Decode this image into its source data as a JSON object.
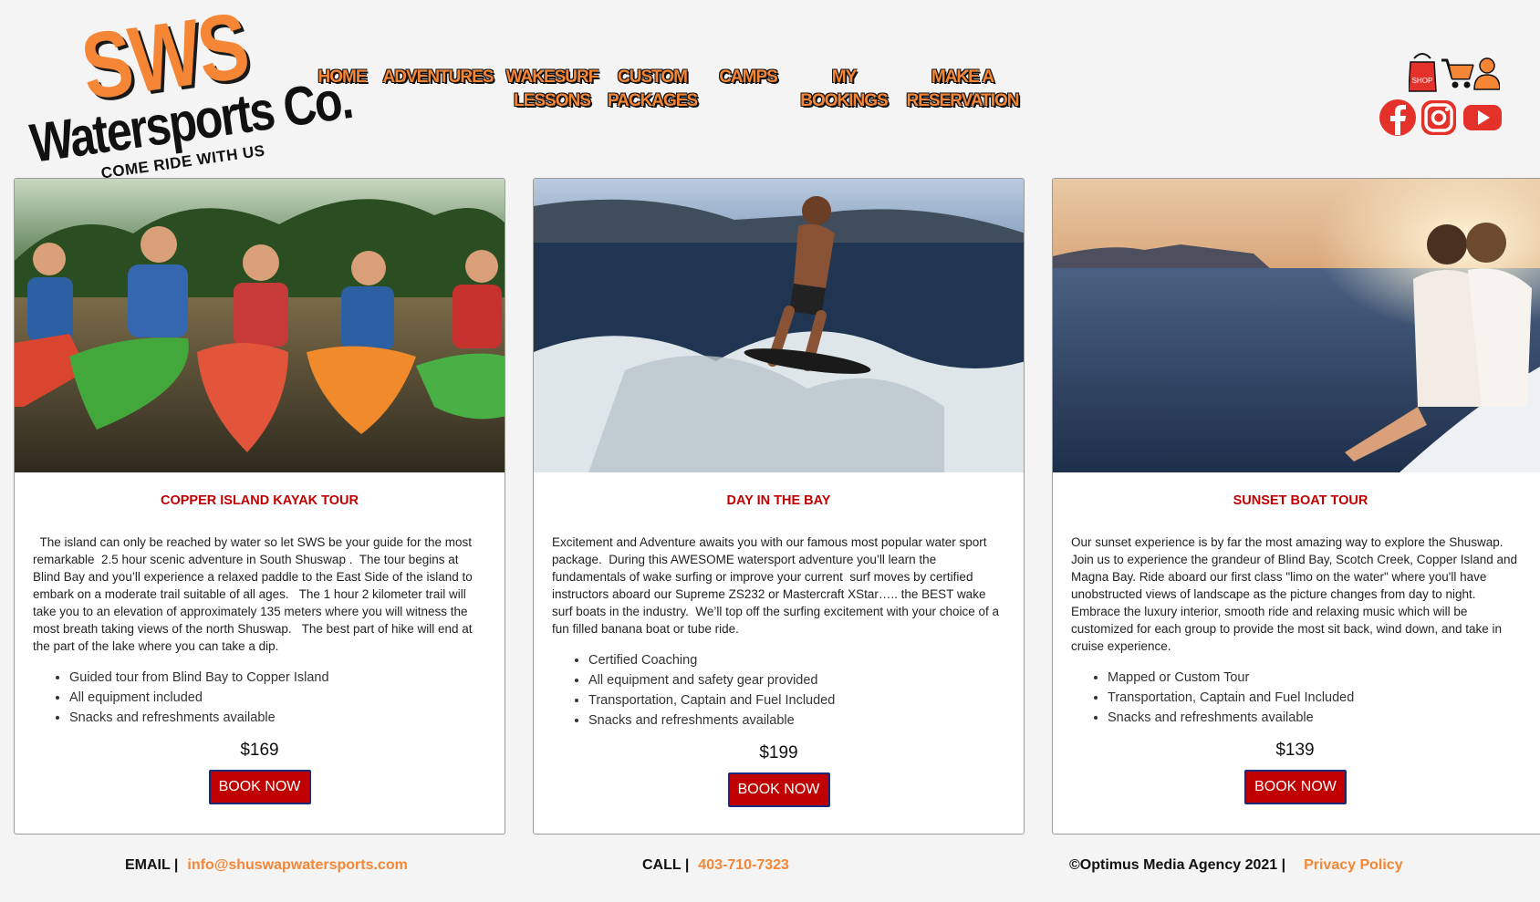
{
  "brand": {
    "logo_main": "SWS",
    "logo_sub": "Watersports Co.",
    "logo_tagline": "COME RIDE WITH US",
    "accent": "#f58636",
    "red": "#c00000"
  },
  "nav": {
    "items": [
      {
        "label": "HOME"
      },
      {
        "label": "ADVENTURES"
      },
      {
        "label": "WAKESURF\nLESSONS"
      },
      {
        "label": "CUSTOM\nPACKAGES"
      },
      {
        "label": "CAMPS"
      },
      {
        "label": "MY\nBOOKINGS"
      },
      {
        "label": "MAKE A\nRESERVATION"
      }
    ]
  },
  "header_icons": {
    "shop_label": "SHOP",
    "icons": [
      "shop-bag-icon",
      "cart-icon",
      "account-icon",
      "facebook-icon",
      "instagram-icon",
      "youtube-icon"
    ]
  },
  "cards": [
    {
      "title": "COPPER ISLAND KAYAK TOUR",
      "description": "  The island can only be reached by water so let SWS be your guide for the most remarkable  2.5 hour scenic adventure in South Shuswap .  The tour begins at Blind Bay and you’ll experience a relaxed paddle to the East Side of the island to embark on a moderate trail suitable of all ages.   The 1 hour 2 kilometer trail will take you to an elevation of approximately 135 meters where you will witness the most breath taking views of the north Shuswap.   The best part of hike will end at the part of the lake where you can take a dip.",
      "bullets": [
        "Guided tour from Blind Bay to Copper Island",
        "All equipment included",
        "Snacks and refreshments available"
      ],
      "price": "$169",
      "button": "BOOK NOW"
    },
    {
      "title": "DAY IN THE BAY",
      "description": "Excitement and Adventure awaits you with our famous most popular water sport package.  During this AWESOME watersport adventure you’ll learn the fundamentals of wake surfing or improve your current  surf moves by certified instructors aboard our Supreme ZS232 or Mastercraft XStar….. the BEST wake surf boats in the industry.  We’ll top off the surfing excitement with your choice of a fun filled banana boat or tube ride.",
      "bullets": [
        "Certified Coaching",
        "All equipment and safety gear provided",
        "Transportation, Captain and Fuel Included",
        "Snacks and refreshments available"
      ],
      "price": "$199",
      "button": "BOOK NOW"
    },
    {
      "title": "SUNSET BOAT TOUR",
      "description": "Our sunset experience is by far the most amazing way to explore the Shuswap.  Join us to experience the grandeur of Blind Bay, Scotch Creek, Copper Island and Magna Bay. Ride aboard our first class \"limo on the water\" where you'll have unobstructed views of landscape as the picture changes from day to night.  Embrace the luxury interior, smooth ride and relaxing music which will be customized for each group to provide the most sit back, wind down, and take in cruise experience.",
      "bullets": [
        "Mapped or Custom Tour",
        "Transportation, Captain and Fuel Included",
        "Snacks and refreshments available"
      ],
      "price": "$139",
      "button": "BOOK NOW"
    }
  ],
  "footer": {
    "email_label": "EMAIL |",
    "email": "info@shuswapwatersports.com",
    "call_label": "CALL |",
    "phone": "403-710-7323",
    "copyright": "©Optimus Media Agency 2021 |",
    "privacy": "Privacy Policy"
  }
}
